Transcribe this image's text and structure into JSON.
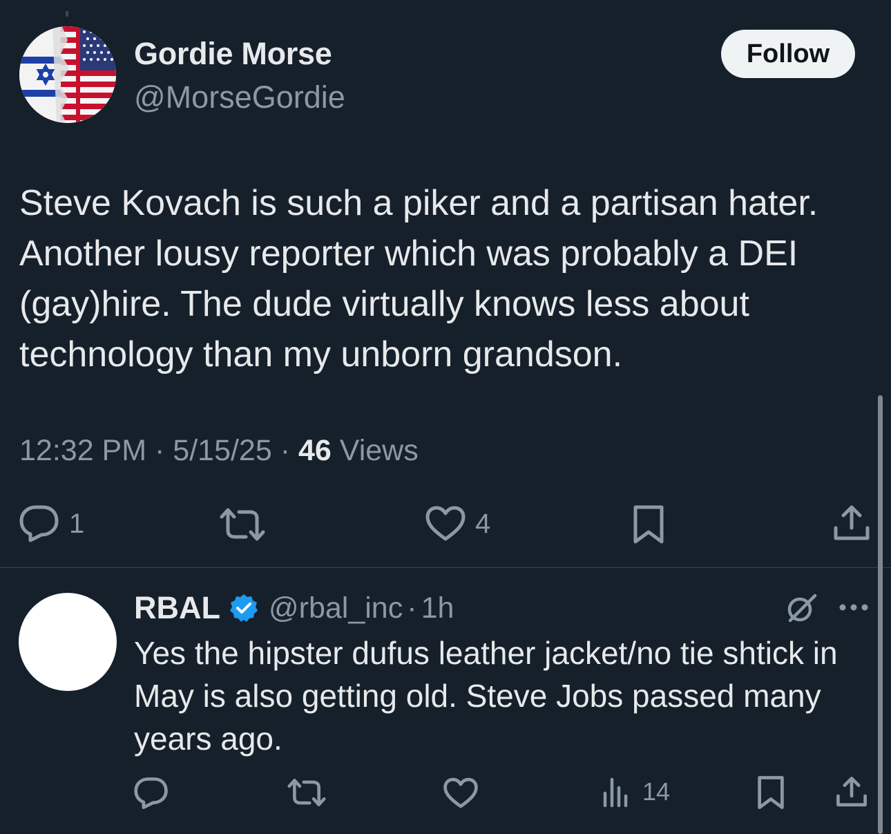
{
  "main_tweet": {
    "author": {
      "name": "Gordie Morse",
      "handle": "@MorseGordie"
    },
    "follow_label": "Follow",
    "text": "Steve Kovach is such a piker and a partisan hater. Another lousy reporter which was probably a DEI (gay)hire. The dude virtually knows less about technology than my unborn grandson.",
    "time": "12:32 PM",
    "date": "5/15/25",
    "separator": "·",
    "views_count": "46",
    "views_label": "Views",
    "actions": {
      "reply_count": "1",
      "like_count": "4"
    }
  },
  "reply": {
    "author": {
      "name": "RBAL",
      "handle": "@rbal_inc",
      "verified": true
    },
    "time": "1h",
    "separator": "·",
    "text": "Yes the hipster dufus leather jacket/no tie shtick in May is also getting old. Steve Jobs passed many years ago.",
    "views_count": "14"
  },
  "colors": {
    "background": "#15202b",
    "text_primary": "#e7e9ea",
    "text_secondary": "#8b98a5",
    "verified_blue": "#1d9bf0",
    "divider": "#38444d"
  },
  "icons": [
    "israel-us-flag-avatar",
    "verified-badge-icon",
    "reply-icon",
    "retweet-icon",
    "like-icon",
    "bookmark-icon",
    "share-icon",
    "grok-icon",
    "more-icon",
    "views-icon"
  ]
}
